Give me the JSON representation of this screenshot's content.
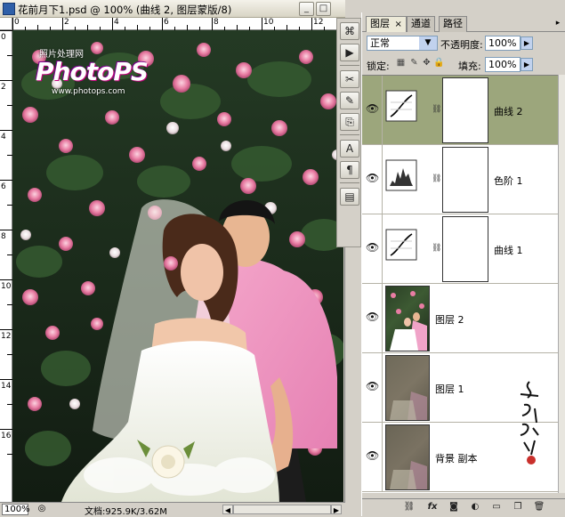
{
  "window": {
    "title": "花前月下1.psd @ 100% (曲线 2, 图层蒙版/8)",
    "min_label": "_",
    "max_label": "□",
    "close_label": "×"
  },
  "rulers": {
    "top": [
      "0",
      "2",
      "4",
      "6",
      "8",
      "10",
      "12"
    ],
    "left": [
      "0",
      "2",
      "4",
      "6",
      "8",
      "10",
      "12",
      "14",
      "16"
    ]
  },
  "watermark": {
    "line1": "照片处理网",
    "logo_text": "PhotoPS",
    "url": "www.photops.com"
  },
  "status": {
    "zoom": "100%",
    "doc_info": "文档:925.9K/3.62M"
  },
  "panel": {
    "tabs": [
      "图层",
      "通道",
      "路径"
    ],
    "tab_close": "×",
    "blend_mode": "正常",
    "opacity_label": "不透明度:",
    "opacity_value": "100%",
    "lock_label": "锁定:",
    "fill_label": "填充:",
    "fill_value": "100%",
    "layers": [
      {
        "name": "曲线 2",
        "kind": "curves",
        "selected": true
      },
      {
        "name": "色阶 1",
        "kind": "levels",
        "selected": false
      },
      {
        "name": "曲线 1",
        "kind": "curves",
        "selected": false
      },
      {
        "name": "图层 2",
        "kind": "photo",
        "selected": false
      },
      {
        "name": "图层 1",
        "kind": "photo-dim",
        "selected": false
      },
      {
        "name": "背景 副本",
        "kind": "photo-dim",
        "selected": false
      }
    ]
  },
  "colors": {
    "selected_row": "#9ca67c",
    "panel_bg": "#d4d0c8",
    "title_gradient_top": "#f4f2ea"
  }
}
